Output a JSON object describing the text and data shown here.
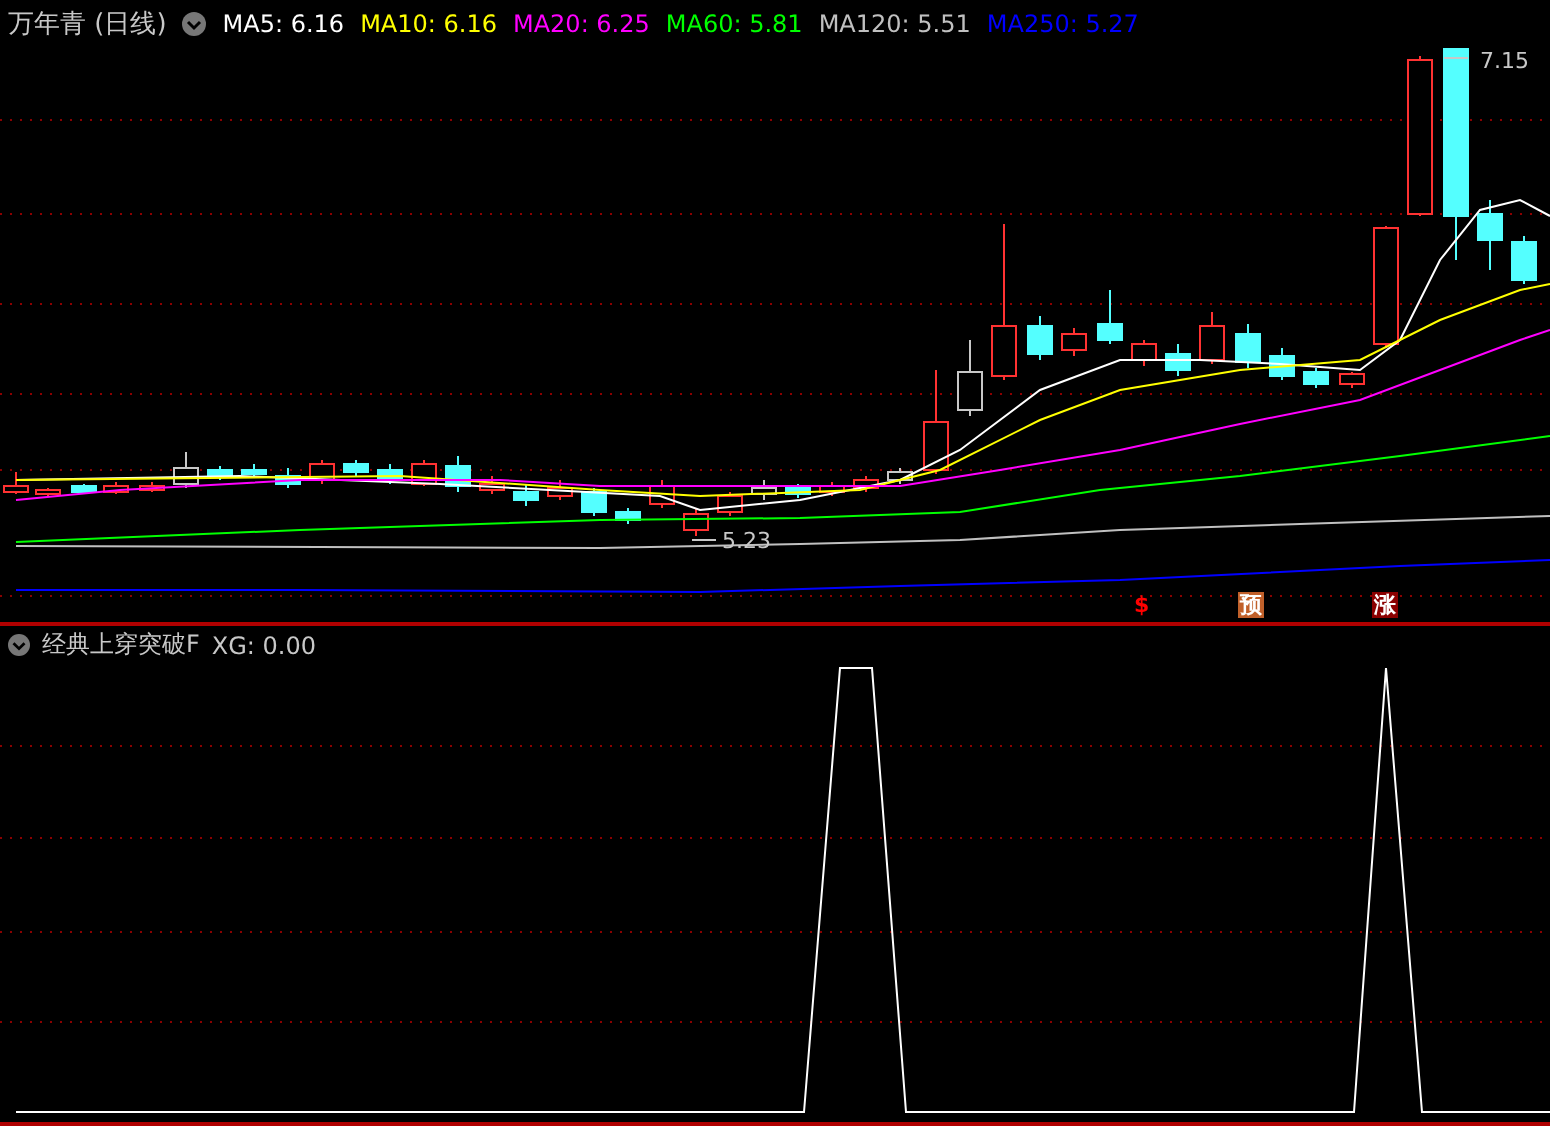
{
  "header": {
    "title": "万年青 (日线)",
    "indicators": [
      {
        "label": "MA5: 6.16",
        "color": "#ffffff"
      },
      {
        "label": "MA10: 6.16",
        "color": "#ffff00"
      },
      {
        "label": "MA20: 6.25",
        "color": "#ff00ff"
      },
      {
        "label": "MA60: 5.81",
        "color": "#00ff00"
      },
      {
        "label": "MA120: 5.51",
        "color": "#c0c0c0"
      },
      {
        "label": "MA250: 5.27",
        "color": "#0000ff"
      }
    ]
  },
  "price_chart": {
    "high_label": "7.15",
    "low_label": "5.23",
    "signals": [
      {
        "text": "$",
        "kind": "arrow",
        "color": "#ff0000"
      },
      {
        "text": "预",
        "kind": "badge",
        "color": "#c0602a"
      },
      {
        "text": "涨",
        "kind": "badge",
        "color": "#8b0000"
      }
    ]
  },
  "indicator_panel": {
    "title": "经典上穿突破F",
    "reading": "XG: 0.00"
  }
}
